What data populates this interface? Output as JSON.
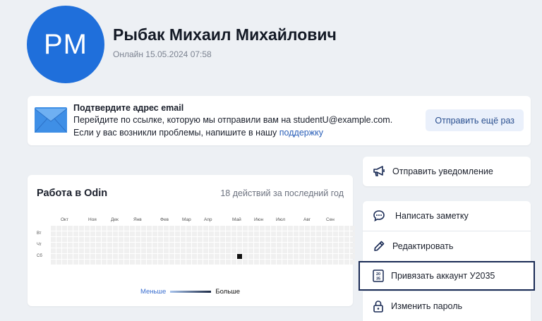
{
  "profile": {
    "initials": "PM",
    "name": "Рыбак Михаил Михайлович",
    "online": "Онлайн 15.05.2024 07:58",
    "avatar_color": "#1f6fdb"
  },
  "email_notice": {
    "icon": "envelope-icon",
    "title": "Подтвердите адрес email",
    "line1": "Перейдите по ссылке, которую мы отправили вам на studentU@example.com.",
    "line2_prefix": "Если у вас возникли проблемы, напишите в нашу",
    "line2_link": "поддержку",
    "resend_label": "Отправить ещё раз"
  },
  "activity": {
    "title": "Работа в Odin",
    "count": "18 действий за последний год",
    "months": [
      "Окт",
      "Ноя",
      "Дек",
      "Янв",
      "Фев",
      "Мар",
      "Апр",
      "Май",
      "Июн",
      "Июл",
      "Авг",
      "Сен"
    ],
    "days": [
      "Вт",
      "Чт",
      "Сб"
    ],
    "legend_less": "Меньше",
    "legend_more": "Больше",
    "active_week": 33,
    "active_day": 5
  },
  "actions": {
    "notify": {
      "label": "Отправить уведомление",
      "icon": "megaphone-icon"
    },
    "note": {
      "label": "Написать заметку",
      "icon": "chat-icon"
    },
    "edit": {
      "label": "Редактировать",
      "icon": "pencil-icon"
    },
    "link_u2035": {
      "label": "Привязать аккаунт У2035",
      "icon": "u2035-icon"
    },
    "password": {
      "label": "Изменить пароль",
      "icon": "lock-icon"
    }
  }
}
